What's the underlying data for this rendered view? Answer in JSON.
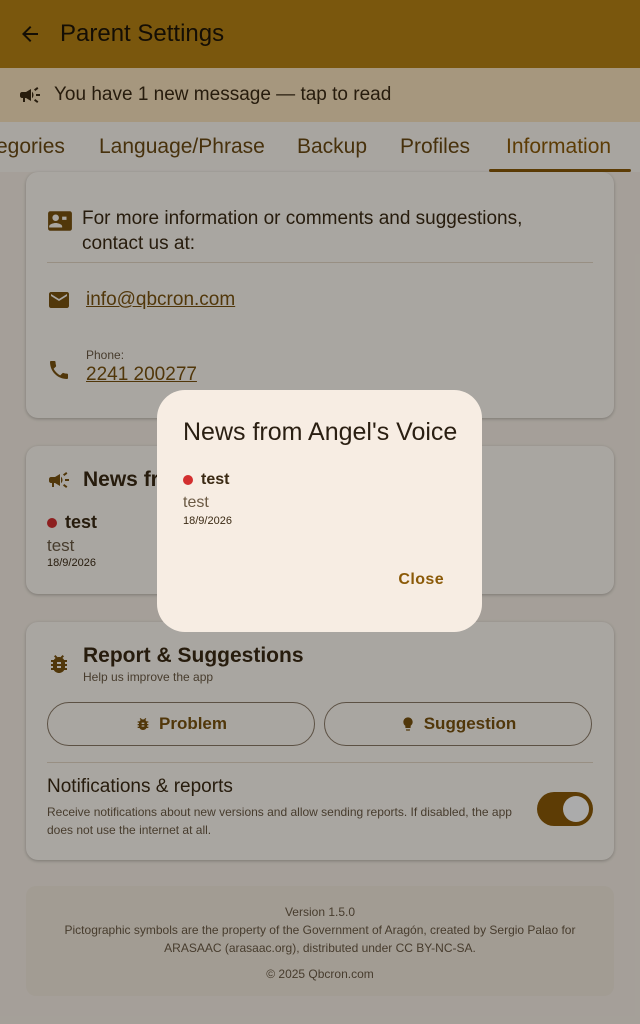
{
  "appbar": {
    "title": "Parent Settings"
  },
  "banner": {
    "text": "You have 1 new message — tap to read"
  },
  "tabs": [
    {
      "label": "egories"
    },
    {
      "label": "Language/Phrase"
    },
    {
      "label": "Backup"
    },
    {
      "label": "Profiles"
    },
    {
      "label": "Information",
      "active": true
    }
  ],
  "contact": {
    "intro": "For more information or comments and suggestions, contact us at:",
    "email": "info@qbcron.com",
    "phone_label": "Phone:",
    "phone": "2241 200277"
  },
  "news": {
    "title": "News fr",
    "item_title": "test",
    "item_body": "test",
    "item_date": "18/9/2026"
  },
  "report": {
    "title": "Report & Suggestions",
    "subtitle": "Help us improve the app",
    "problem_label": "Problem",
    "suggestion_label": "Suggestion",
    "notif_title": "Notifications & reports",
    "notif_desc": "Receive notifications about new versions and allow sending reports. If disabled, the app does not use the internet at all.",
    "notif_enabled": true
  },
  "footer": {
    "version": "Version 1.5.0",
    "credits": "Pictographic symbols are the property of the Government of Aragón, created by Sergio Palao for ARASAAC (arasaac.org), distributed under CC BY-NC-SA.",
    "copyright": "© 2025 Qbcron.com"
  },
  "dialog": {
    "title": "News from Angel's Voice",
    "item_title": "test",
    "item_body": "test",
    "item_date": "18/9/2026",
    "close_label": "Close"
  },
  "colors": {
    "appbar": "#b78214",
    "accent": "#8b5a08",
    "banner": "#f8e2bd",
    "unread_dot": "#d32f2f"
  }
}
